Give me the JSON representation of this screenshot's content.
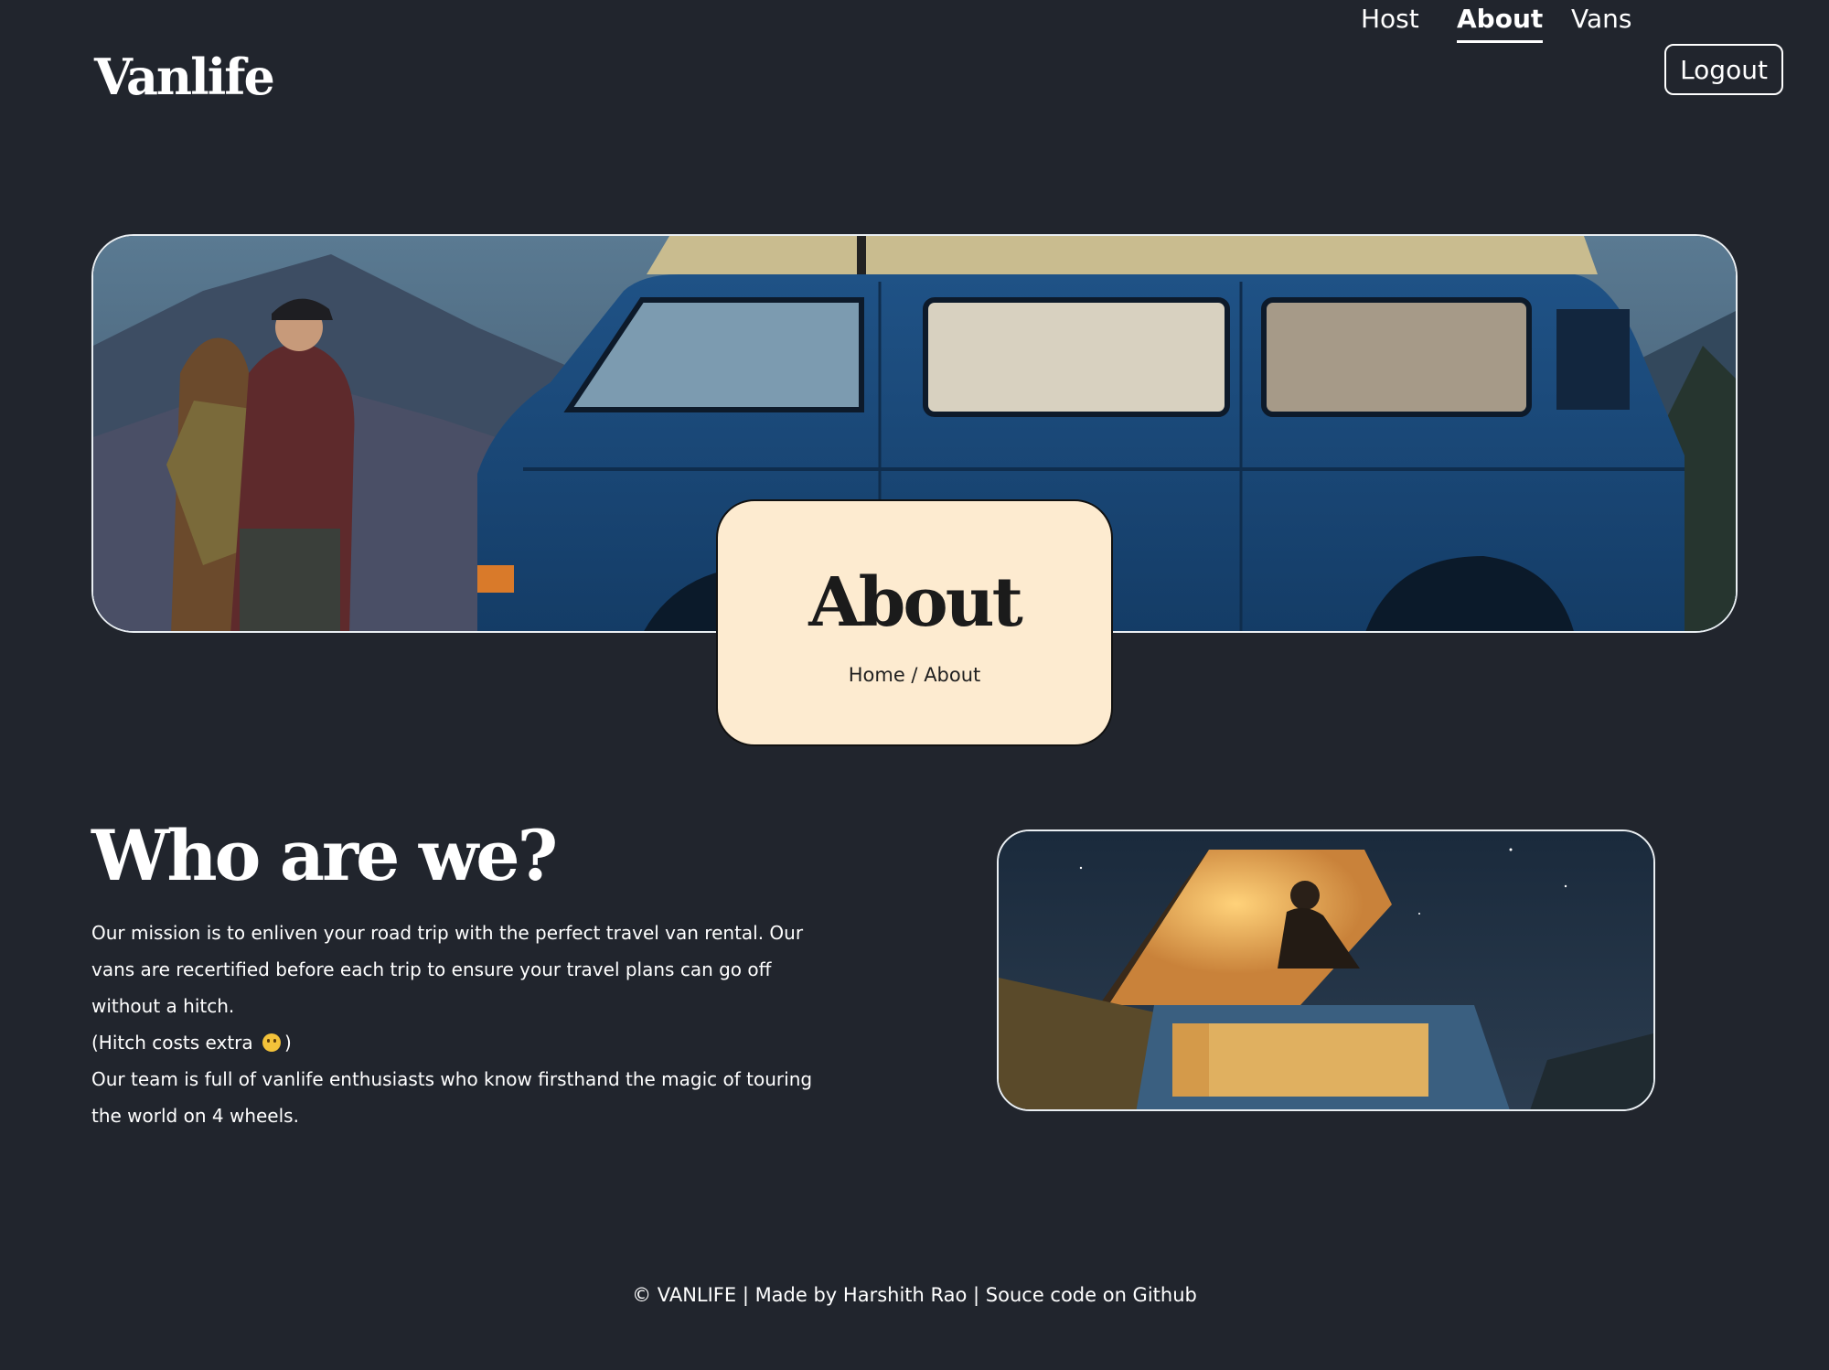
{
  "header": {
    "logo": "Vanlife",
    "nav": {
      "host": "Host",
      "about": "About",
      "vans": "Vans",
      "logout": "Logout"
    }
  },
  "hero": {
    "image_alt": "Couple standing beside a blue camper van in the mountains",
    "title": "About",
    "breadcrumb": {
      "home": "Home",
      "separator": "/",
      "current": "About"
    }
  },
  "who": {
    "title": "Who are we?",
    "para1": "Our mission is to enliven your road trip with the perfect travel van rental. Our vans are recertified before each trip to ensure your travel plans can go off without a hitch.",
    "para2_prefix": "(Hitch costs extra",
    "para2_suffix": ")",
    "para3": "Our team is full of vanlife enthusiasts who know firsthand the magic of touring the world on 4 wheels.",
    "image_alt": "Person sitting on top of a lit camper van at night"
  },
  "footer": {
    "text": "© VANLIFE | Made by Harshith Rao | Souce code on Github"
  },
  "colors": {
    "background": "#21252d",
    "card": "#fdebd0",
    "text": "#ffffff",
    "van_blue": "#1d4a78"
  },
  "icons": {
    "emoji": "winking-face-icon"
  }
}
